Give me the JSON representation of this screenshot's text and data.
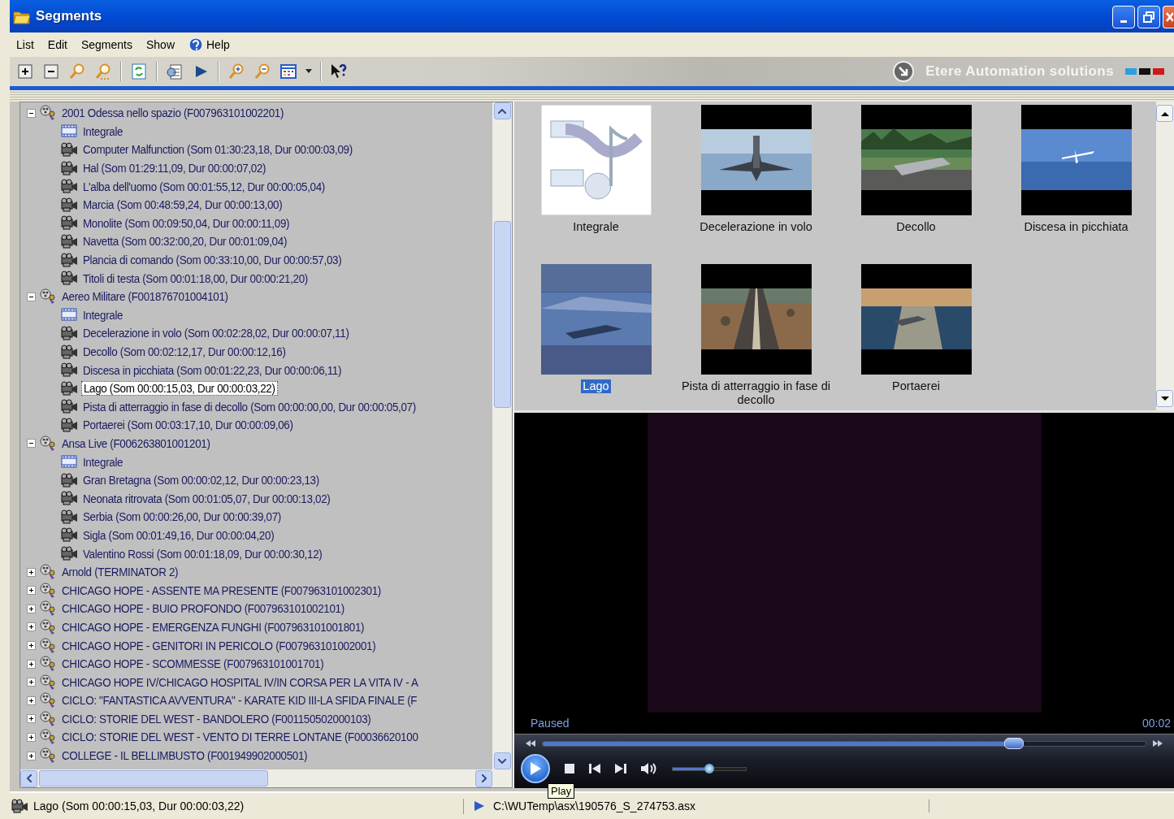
{
  "window": {
    "title": "Segments"
  },
  "menu": [
    "List",
    "Edit",
    "Segments",
    "Show",
    "Help"
  ],
  "logo": {
    "text": "Etere Automation solutions"
  },
  "tree": [
    {
      "label": "2001 Odessa nello spazio (F007963101002201)",
      "expanded": true,
      "children": [
        {
          "kind": "film",
          "label": "Integrale",
          "selected": false
        },
        {
          "kind": "segment",
          "label": "Computer Malfunction (Som 01:30:23,18, Dur 00:00:03,09)",
          "selected": false
        },
        {
          "kind": "segment",
          "label": "Hal (Som 01:29:11,09, Dur 00:00:07,02)",
          "selected": false
        },
        {
          "kind": "segment",
          "label": "L'alba dell'uomo (Som 00:01:55,12, Dur 00:00:05,04)",
          "selected": false
        },
        {
          "kind": "segment",
          "label": "Marcia (Som 00:48:59,24, Dur 00:00:13,00)",
          "selected": false
        },
        {
          "kind": "segment",
          "label": "Monolite (Som 00:09:50,04, Dur 00:00:11,09)",
          "selected": false
        },
        {
          "kind": "segment",
          "label": "Navetta (Som 00:32:00,20, Dur 00:01:09,04)",
          "selected": false
        },
        {
          "kind": "segment",
          "label": "Plancia di comando (Som 00:33:10,00, Dur 00:00:57,03)",
          "selected": false
        },
        {
          "kind": "segment",
          "label": "Titoli di testa (Som 00:01:18,00, Dur 00:00:21,20)",
          "selected": false
        }
      ]
    },
    {
      "label": "Aereo Militare (F001876701004101)",
      "expanded": true,
      "children": [
        {
          "kind": "film",
          "label": "Integrale",
          "selected": false
        },
        {
          "kind": "segment",
          "label": "Decelerazione in volo (Som 00:02:28,02, Dur 00:00:07,11)",
          "selected": false
        },
        {
          "kind": "segment",
          "label": "Decollo (Som 00:02:12,17, Dur 00:00:12,16)",
          "selected": false
        },
        {
          "kind": "segment",
          "label": "Discesa in picchiata (Som 00:01:22,23, Dur 00:00:06,11)",
          "selected": false
        },
        {
          "kind": "segment",
          "label": "Lago (Som 00:00:15,03, Dur 00:00:03,22)",
          "selected": true
        },
        {
          "kind": "segment",
          "label": "Pista di atterraggio in fase di decollo (Som 00:00:00,00, Dur 00:00:05,07)",
          "selected": false
        },
        {
          "kind": "segment",
          "label": "Portaerei (Som 00:03:17,10, Dur 00:00:09,06)",
          "selected": false
        }
      ]
    },
    {
      "label": "Ansa Live (F006263801001201)",
      "expanded": true,
      "children": [
        {
          "kind": "film",
          "label": "Integrale",
          "selected": false
        },
        {
          "kind": "segment",
          "label": "Gran Bretagna (Som 00:00:02,12, Dur 00:00:23,13)",
          "selected": false
        },
        {
          "kind": "segment",
          "label": "Neonata ritrovata (Som 00:01:05,07, Dur 00:00:13,02)",
          "selected": false
        },
        {
          "kind": "segment",
          "label": "Serbia (Som 00:00:26,00, Dur 00:00:39,07)",
          "selected": false
        },
        {
          "kind": "segment",
          "label": "Sigla (Som 00:01:49,16, Dur 00:00:04,20)",
          "selected": false
        },
        {
          "kind": "segment",
          "label": "Valentino Rossi (Som 00:01:18,09, Dur 00:00:30,12)",
          "selected": false
        }
      ]
    },
    {
      "label": "Arnold (TERMINATOR 2)",
      "expanded": false
    },
    {
      "label": "CHICAGO HOPE - ASSENTE MA PRESENTE (F007963101002301)",
      "expanded": false
    },
    {
      "label": "CHICAGO HOPE - BUIO PROFONDO (F007963101002101)",
      "expanded": false
    },
    {
      "label": "CHICAGO HOPE - EMERGENZA FUNGHI (F007963101001801)",
      "expanded": false
    },
    {
      "label": "CHICAGO HOPE - GENITORI IN PERICOLO (F007963101002001)",
      "expanded": false
    },
    {
      "label": "CHICAGO HOPE - SCOMMESSE (F007963101001701)",
      "expanded": false
    },
    {
      "label": "CHICAGO HOPE IV/CHICAGO HOSPITAL IV/IN CORSA PER LA VITA IV - A",
      "expanded": false
    },
    {
      "label": "CICLO: \"FANTASTICA AVVENTURA\" - KARATE KID III-LA SFIDA FINALE (F",
      "expanded": false
    },
    {
      "label": "CICLO: STORIE DEL WEST - BANDOLERO (F001150502000103)",
      "expanded": false
    },
    {
      "label": "CICLO: STORIE DEL WEST - VENTO DI TERRE LONTANE (F00036620100",
      "expanded": false
    },
    {
      "label": "COLLEGE - IL BELLIMBUSTO (F001949902000501)",
      "expanded": false
    }
  ],
  "thumbnails": [
    {
      "kind": "icon",
      "label": "Integrale",
      "selected": false
    },
    {
      "kind": "picture",
      "label": "Decelerazione in volo",
      "selected": false
    },
    {
      "kind": "picture",
      "label": "Decollo",
      "selected": false
    },
    {
      "kind": "picture",
      "label": "Discesa in picchiata",
      "selected": false
    },
    {
      "kind": "picture",
      "label": "Lago",
      "selected": true
    },
    {
      "kind": "picture",
      "label": "Pista di atterraggio in fase di decollo",
      "selected": false
    },
    {
      "kind": "picture",
      "label": "Portaerei",
      "selected": false
    }
  ],
  "player": {
    "state": "Paused",
    "time": "00:02",
    "seek": {
      "level": 0.78
    },
    "volume": {
      "level": 0.5
    },
    "tooltip": "Play"
  },
  "status_bar": {
    "segment": "Lago (Som 00:00:15,03, Dur 00:00:03,22)",
    "path": "C:\\WUTemp\\asx\\190576_S_274753.asx"
  }
}
